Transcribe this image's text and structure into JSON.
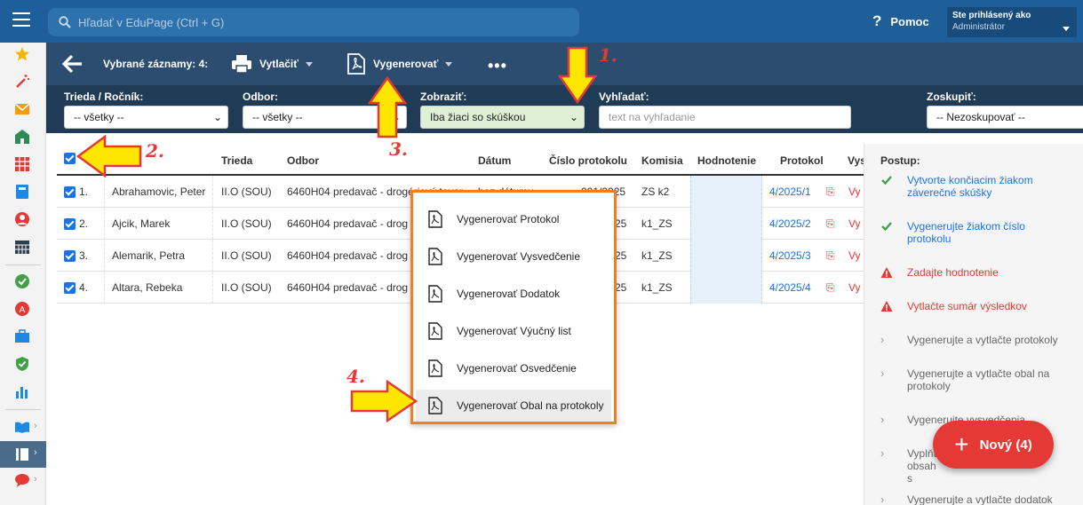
{
  "topbar": {
    "search_placeholder": "Hľadať v EduPage (Ctrl + G)",
    "help_label": "Pomoc",
    "account_line1": "Ste prihlásený ako",
    "account_line2": "Administrátor"
  },
  "actionbar": {
    "selected_label": "Vybrané záznamy: 4:",
    "print_label": "Vytlačiť",
    "generate_label": "Vygenerovať",
    "more_label": "•••"
  },
  "filters": {
    "class_label": "Trieda / Ročník:",
    "class_value": "-- všetky --",
    "field_label": "Odbor:",
    "field_value": "-- všetky --",
    "show_label": "Zobraziť:",
    "show_value": "Iba žiaci so skúškou",
    "search_label": "Vyhľadať:",
    "search_placeholder": "text na vyhľadanie",
    "group_label": "Zoskupiť:",
    "group_value": "-- Nezoskupovať --"
  },
  "table": {
    "headers": {
      "trieda": "Trieda",
      "odbor": "Odbor",
      "datum": "Dátum",
      "cislo": "Číslo protokolu",
      "komisia": "Komisia",
      "hodnotenie": "Hodnotenie",
      "protokol": "Protokol",
      "vys": "Vys"
    },
    "rows": [
      {
        "num": "1.",
        "name": "Abrahamovic, Peter",
        "trieda": "II.O (SOU)",
        "odbor": "6460H04 predavač - drogériový tovar",
        "datum": "bez dátumu",
        "cislo": "001/2025",
        "komisia": "ZS k2",
        "protokol": "4/2025/1",
        "vys": "Vy"
      },
      {
        "num": "2.",
        "name": "Ajcik, Marek",
        "trieda": "II.O (SOU)",
        "odbor": "6460H04 predavač - drog",
        "datum": "",
        "cislo": "25",
        "komisia": "k1_ZS",
        "protokol": "4/2025/2",
        "vys": "Vy"
      },
      {
        "num": "3.",
        "name": "Alemarik, Petra",
        "trieda": "II.O (SOU)",
        "odbor": "6460H04 predavač - drog",
        "datum": "",
        "cislo": "25",
        "komisia": "k1_ZS",
        "protokol": "4/2025/3",
        "vys": "Vy"
      },
      {
        "num": "4.",
        "name": "Altara, Rebeka",
        "trieda": "II.O (SOU)",
        "odbor": "6460H04 predavač - drog",
        "datum": "",
        "cislo": "25",
        "komisia": "k1_ZS",
        "protokol": "4/2025/4",
        "vys": "Vy"
      }
    ]
  },
  "menu": {
    "items": [
      "Vygenerovať Protokol",
      "Vygenerovať Vysvedčenie",
      "Vygenerovať Dodatok",
      "Vygenerovať Výučný list",
      "Vygenerovať Osvedčenie",
      "Vygenerovať Obal na protokoly"
    ]
  },
  "panel": {
    "title": "Postup:",
    "steps": [
      {
        "text": "Vytvorte končiacim žiakom záverečné skúšky",
        "status": "done"
      },
      {
        "text": "Vygenerujte žiakom číslo protokolu",
        "status": "done"
      },
      {
        "text": "Zadajte hodnotenie",
        "status": "warn"
      },
      {
        "text": "Vytlačte sumár výsledkov",
        "status": "warn"
      },
      {
        "text": "Vygenerujte a vytlačte protokoly",
        "status": "todo"
      },
      {
        "text": "Vygenerujte a vytlačte obal na protokoly",
        "status": "todo"
      },
      {
        "text": "Vygenerujte vysvedčenia",
        "status": "todo"
      },
      {
        "text": "Vyplňte obsah s",
        "status": "todo"
      },
      {
        "text": "Vygenerujte a vytlačte dodatok",
        "status": "todo"
      }
    ]
  },
  "fab": {
    "label": "Nový (4)"
  },
  "annotations": [
    "1.",
    "2.",
    "3.",
    "4."
  ],
  "colors": {
    "topbar": "#1f5f99",
    "actionbar": "#2c4d6f",
    "filterbar": "#1f3b56",
    "accent": "#1a73e8",
    "warn": "#e53935",
    "menu_border": "#f07f21",
    "annotation_arrow": "#ffe600"
  }
}
